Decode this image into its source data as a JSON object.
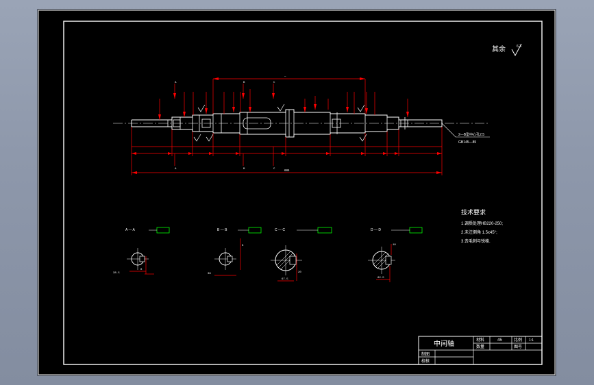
{
  "surplus_label": "其余",
  "surplus_roughness": "6.3",
  "length_dim": "684",
  "center_hole_note_1": "2—B型中心孔2.5",
  "center_hole_note_2": "GB145—85",
  "sections": [
    {
      "title": "A — A",
      "width_dim": "8",
      "depth_dim": "38.5"
    },
    {
      "title": "B — B",
      "width_dim": "8",
      "depth_dim": "39"
    },
    {
      "title": "C — C",
      "width_dim": "20",
      "depth_dim": "67.5"
    },
    {
      "title": "D — D",
      "width_dim": "18",
      "depth_dim": "62.5"
    }
  ],
  "tech_req": {
    "title": "技术要求",
    "items": [
      "1.调质处理HB220-250;",
      "2.未注倒角 1.5x45°;",
      "3.去毛刺与锐棱."
    ]
  },
  "title_block": {
    "part_name": "中间轴",
    "material_label": "材料",
    "material_value": "45",
    "scale_label": "比例",
    "scale_value": "1:1",
    "qty_label": "数量",
    "drawing_no_label": "图号",
    "drawn_label": "制图",
    "checked_label": "校核"
  },
  "colors": {
    "sheet_bg": "#000000",
    "lines": "#ffffff",
    "dimensions": "#ff0000",
    "tolerance": "#00ff00"
  }
}
